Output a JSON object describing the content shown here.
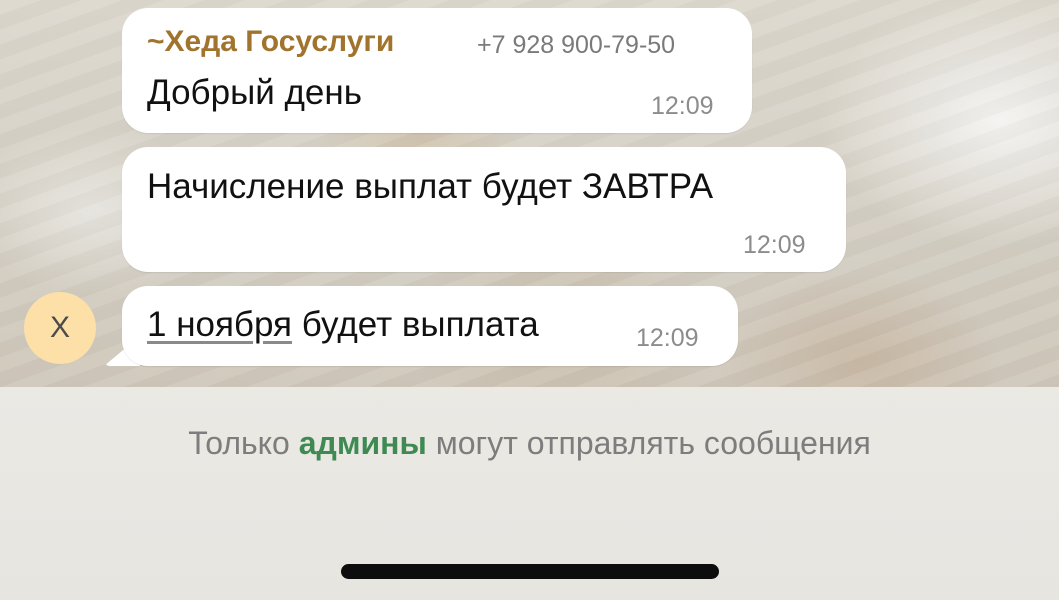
{
  "chat": {
    "messages": [
      {
        "sender_prefix": "~",
        "sender_name": "Хеда Госуслуги",
        "sender_phone": "+7 928 900-79-50",
        "text": "Добрый день",
        "time": "12:09"
      },
      {
        "text": "Начисление выплат будет ЗАВТРА",
        "time": "12:09"
      },
      {
        "text_link": "1 ноября",
        "text_rest": " будет выплата",
        "time": "12:09",
        "avatar_initial": "Х"
      }
    ]
  },
  "footer": {
    "notice_before": "Только ",
    "notice_admins": "админы",
    "notice_after": " могут отправлять сообщения"
  },
  "colors": {
    "sender_name": "#a1742d",
    "admins_highlight": "#3f8a53",
    "avatar_bg": "#fddfa8",
    "bubble_bg": "#ffffff"
  }
}
